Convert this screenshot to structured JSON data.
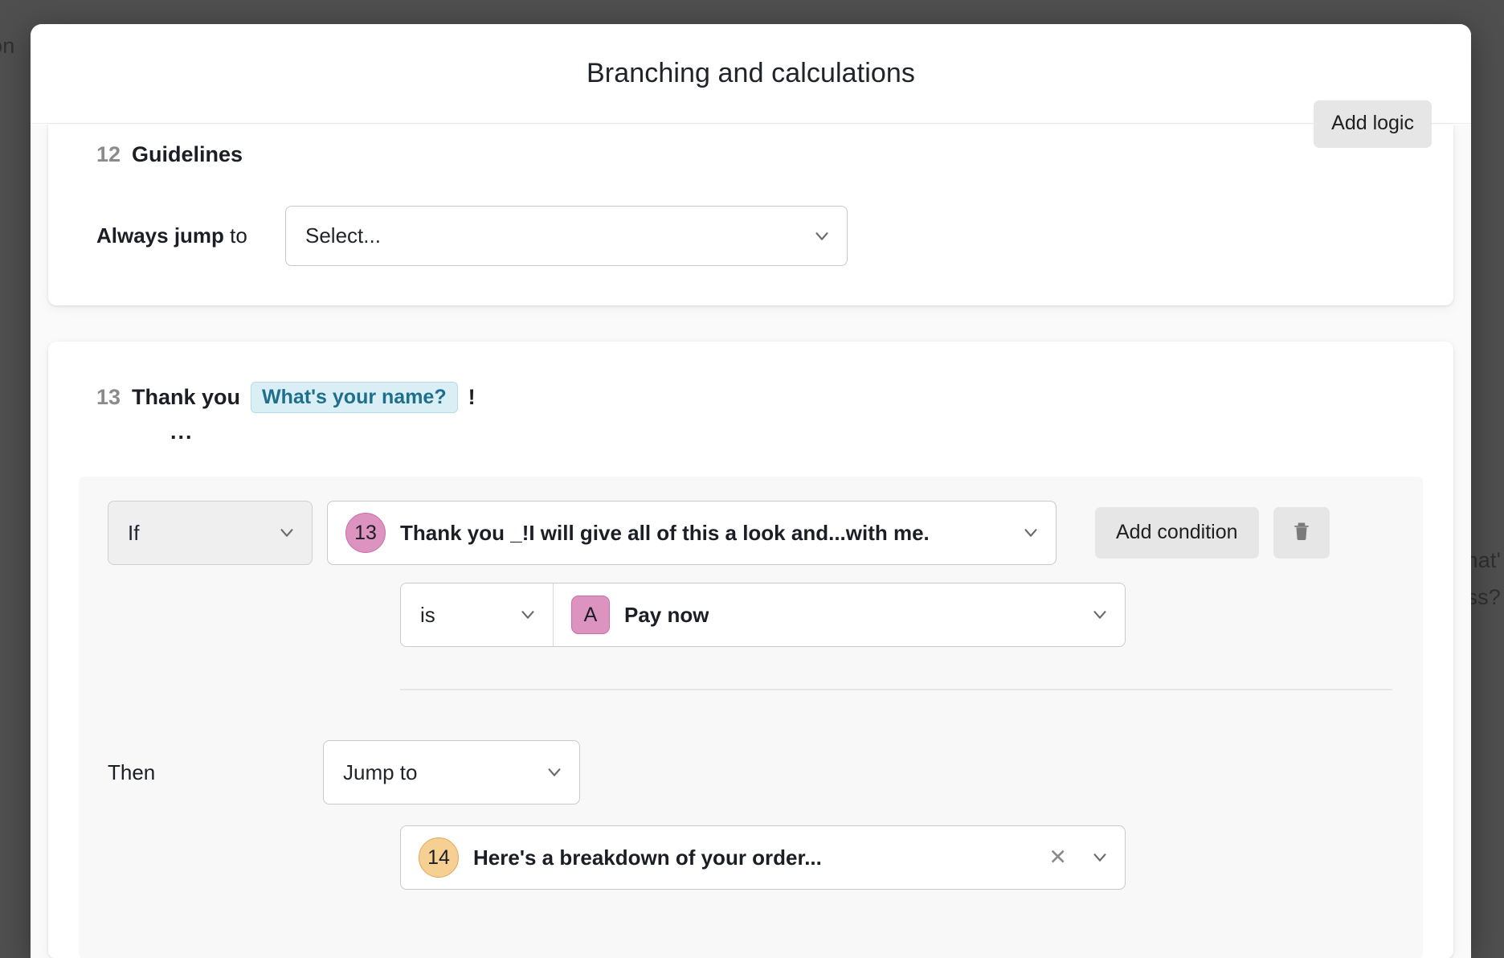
{
  "background": {
    "left_fragment": "on",
    "right_fragment_1": "hat'",
    "right_fragment_2": "ess?"
  },
  "modal": {
    "title": "Branching and calculations"
  },
  "questions": [
    {
      "number": "12",
      "title": "Guidelines",
      "add_logic_label": "Add logic",
      "always_jump": {
        "label_bold": "Always jump",
        "label_rest": " to",
        "select_value": "Select...",
        "chevron_icon": "chevron-down-icon"
      }
    },
    {
      "number": "13",
      "title_prefix": "Thank you",
      "title_pill": "What's your name?",
      "title_suffix": "!",
      "ellipsis": "...",
      "logic": {
        "if_operator": "If",
        "if_target": {
          "badge": "13",
          "badge_color": "#dd93bf",
          "text": "Thank you _!I will give all of this a look and...with me."
        },
        "condition_operator": "is",
        "condition_value": {
          "badge": "A",
          "badge_color": "#dd93bf",
          "text": "Pay now"
        },
        "add_condition_label": "Add condition",
        "delete_icon": "trash-icon",
        "then_label": "Then",
        "then_action": "Jump to",
        "then_target": {
          "badge": "14",
          "badge_color": "#f6cf93",
          "text": "Here's a breakdown of your order...",
          "clear_icon": "close-icon"
        }
      }
    }
  ],
  "colors": {
    "pill_bg": "#daeef5",
    "pill_text": "#1e6f8c",
    "button_grey": "#e6e6e6",
    "backdrop": "#4f4f4f"
  }
}
